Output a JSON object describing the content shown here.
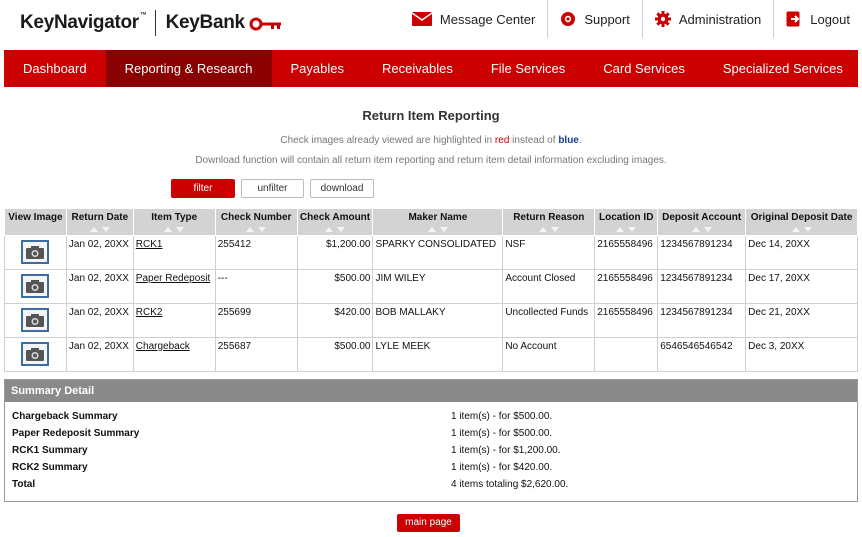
{
  "brand": {
    "keynavigator": "KeyNavigator",
    "tm": "™",
    "keybank": "KeyBank"
  },
  "utilities": [
    {
      "label": "Message Center",
      "icon": "envelope-icon"
    },
    {
      "label": "Support",
      "icon": "lifebuoy-icon"
    },
    {
      "label": "Administration",
      "icon": "gear-icon"
    },
    {
      "label": "Logout",
      "icon": "logout-icon"
    }
  ],
  "nav": [
    {
      "label": "Dashboard"
    },
    {
      "label": "Reporting & Research",
      "active": true
    },
    {
      "label": "Payables"
    },
    {
      "label": "Receivables"
    },
    {
      "label": "File Services"
    },
    {
      "label": "Card Services"
    },
    {
      "label": "Specialized Services"
    }
  ],
  "page": {
    "title": "Return Item Reporting",
    "note1_before": "Check images already viewed are highlighted in",
    "note1_red": "red",
    "note1_mid": "instead of",
    "note1_blue": "blue",
    "note1_end": ".",
    "note2": "Download function will contain all return item reporting and return item detail information excluding images."
  },
  "buttons": {
    "filter": "filter",
    "unfilter": "unfilter",
    "download": "download",
    "main_page": "main page"
  },
  "colors": {
    "brand_red": "#cc0000",
    "active_nav": "#8b0000",
    "summary_header": "#8a8a8a"
  },
  "table": {
    "columns": [
      "View Image",
      "Return Date",
      "Item Type",
      "Check Number",
      "Check Amount",
      "Maker Name",
      "Return Reason",
      "Location ID",
      "Deposit Account",
      "Original Deposit Date"
    ],
    "rows": [
      [
        "",
        "Jan 02, 20XX",
        "RCK1",
        "255412",
        "$1,200.00",
        "SPARKY CONSOLIDATED",
        "NSF",
        "2165558496",
        "1234567891234",
        "Dec 14, 20XX"
      ],
      [
        "",
        "Jan 02, 20XX",
        "Paper Redeposit",
        "---",
        "$500.00",
        "JIM WILEY",
        "Account Closed",
        "2165558496",
        "1234567891234",
        "Dec 17, 20XX"
      ],
      [
        "",
        "Jan 02, 20XX",
        "RCK2",
        "255699",
        "$420.00",
        "BOB MALLAKY",
        "Uncollected Funds",
        "2165558496",
        "1234567891234",
        "Dec 21, 20XX"
      ],
      [
        "",
        "Jan 02, 20XX",
        "Chargeback",
        "255687",
        "$500.00",
        "LYLE MEEK",
        "No Account",
        "",
        "6546546546542",
        "Dec 3, 20XX"
      ]
    ]
  },
  "summary": {
    "title": "Summary Detail",
    "rows": [
      {
        "label": "Chargeback Summary",
        "value": "1 item(s) - for $500.00."
      },
      {
        "label": "Paper Redeposit Summary",
        "value": "1 item(s) - for $500.00."
      },
      {
        "label": "RCK1 Summary",
        "value": "1 item(s) - for $1,200.00."
      },
      {
        "label": "RCK2 Summary",
        "value": "1 item(s) - for $420.00."
      },
      {
        "label": "Total",
        "value": "4 items totaling $2,620.00."
      }
    ]
  }
}
